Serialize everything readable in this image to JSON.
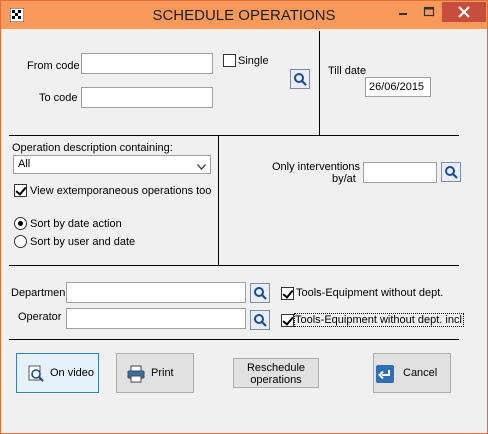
{
  "window": {
    "title": "SCHEDULE OPERATIONS"
  },
  "codes": {
    "from_label": "From code",
    "from_value": "",
    "to_label": "To code",
    "to_value": "",
    "single_label": "Single",
    "single_checked": false
  },
  "till": {
    "label": "Till date",
    "value": "26/06/2015"
  },
  "description": {
    "label": "Operation description containing:",
    "selected": "All",
    "view_extemp_label": "View extemporaneous operations too",
    "view_extemp_checked": true
  },
  "sort": {
    "by_date_label": "Sort by date action",
    "by_user_label": "Sort by user and date",
    "selected": "by_date"
  },
  "interventions": {
    "label_line1": "Only interventions",
    "label_line2": "by/at",
    "value": ""
  },
  "department": {
    "label": "Departmen",
    "value": "",
    "tools_label": "Tools-Equipment without dept.",
    "tools_checked": true
  },
  "operator": {
    "label": "Operator",
    "value": "",
    "tools_label": "Tools-Equipment without dept. incl",
    "tools_checked": true
  },
  "buttons": {
    "on_video": "On video",
    "print": "Print",
    "reschedule_line1": "Reschedule",
    "reschedule_line2": "operations",
    "cancel": "Cancel"
  },
  "icons": {
    "app": "app-grid-icon",
    "search": "search-icon",
    "on_video": "magnifier-document-icon",
    "print": "printer-icon",
    "cancel": "cancel-arrow-icon"
  },
  "colors": {
    "titlebar": "#f89a5c",
    "close_button": "#c74d3c",
    "border": "#e46d34"
  }
}
